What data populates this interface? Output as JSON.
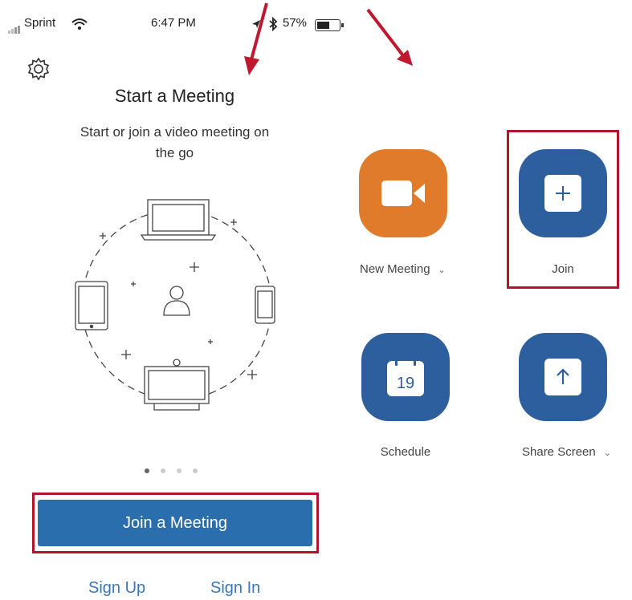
{
  "status_bar": {
    "carrier": "Sprint",
    "time": "6:47 PM",
    "battery": "57%"
  },
  "left_panel": {
    "title": "Start a Meeting",
    "subtitle_line1": "Start or join a video meeting on",
    "subtitle_line2": "the go",
    "carousel": {
      "pages": 4,
      "current": 1
    },
    "join_button": "Join a Meeting",
    "sign_up": "Sign Up",
    "sign_in": "Sign In"
  },
  "right_panel": {
    "tiles": [
      {
        "label": "New Meeting",
        "icon": "video-camera-icon",
        "color": "#e07b2b",
        "dropdown": true
      },
      {
        "label": "Join",
        "icon": "plus-icon",
        "color": "#2d5f9e",
        "dropdown": false,
        "highlighted": true
      },
      {
        "label": "Schedule",
        "icon": "calendar-icon",
        "color": "#2d5f9e",
        "calendar_day": "19",
        "dropdown": false
      },
      {
        "label": "Share Screen",
        "icon": "share-upload-icon",
        "color": "#2d5f9e",
        "dropdown": true
      }
    ]
  },
  "colors": {
    "accent": "#2b6ead",
    "orange": "#e07b2b",
    "highlight_red": "#b5122b",
    "annotation_arrow": "#c0182e"
  }
}
